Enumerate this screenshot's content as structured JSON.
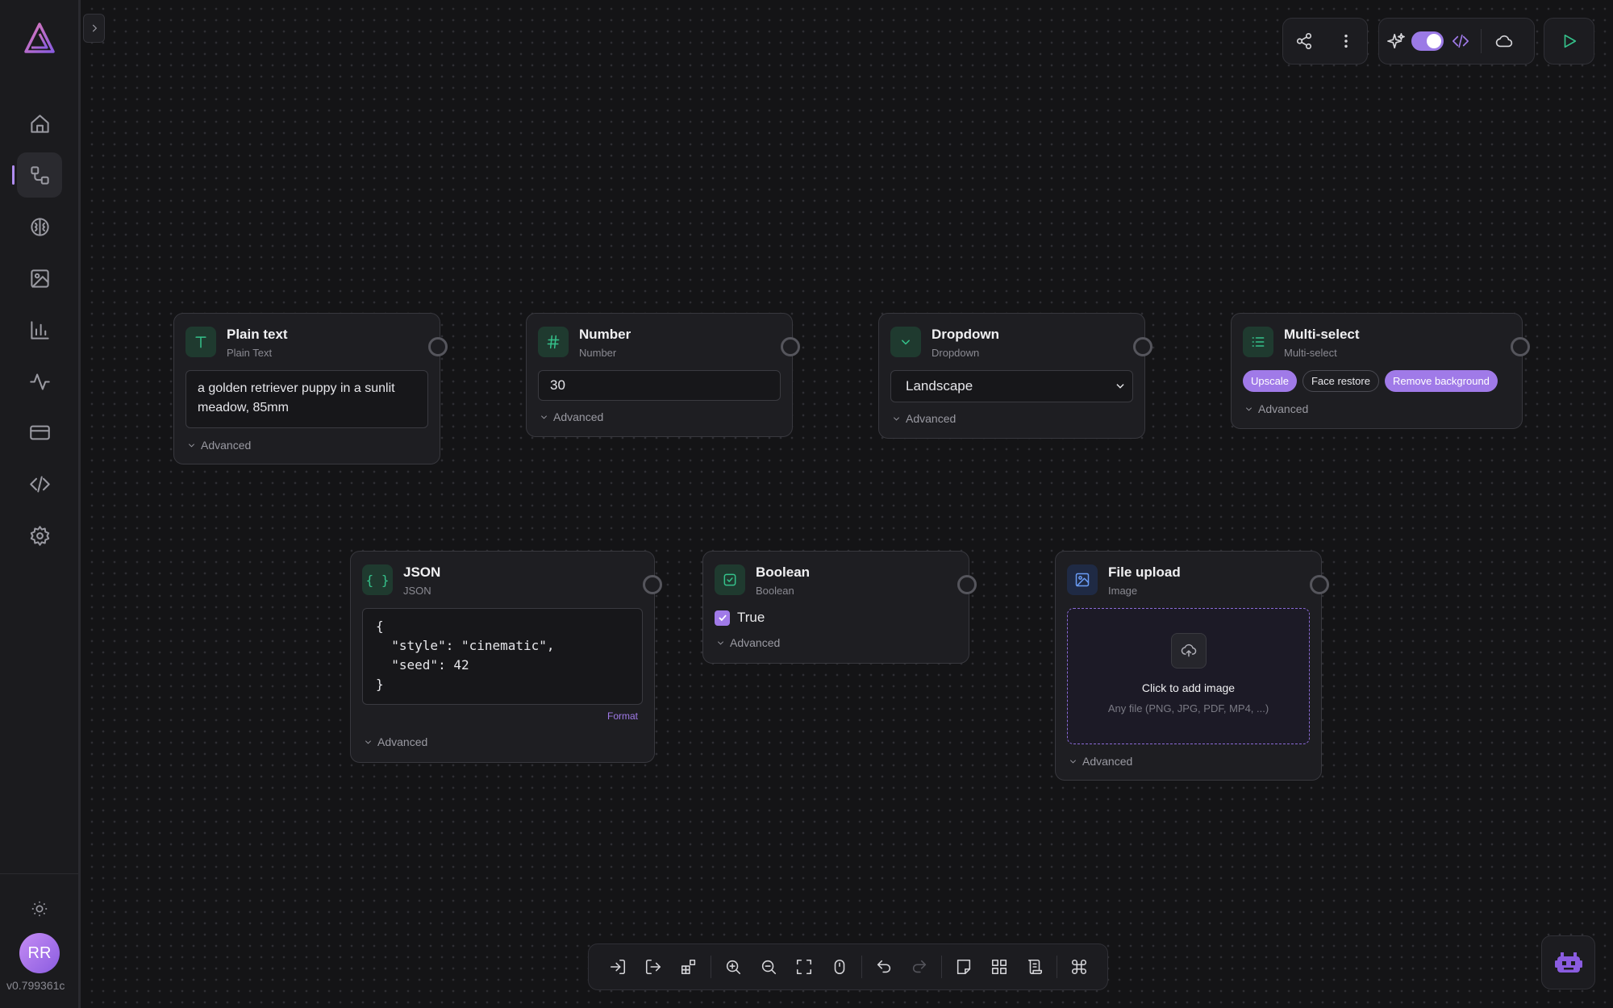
{
  "sidebar": {
    "nav": [
      {
        "name": "home",
        "icon": "home-icon"
      },
      {
        "name": "workflows",
        "icon": "workflow-icon",
        "active": true
      },
      {
        "name": "models",
        "icon": "brain-icon"
      },
      {
        "name": "gallery",
        "icon": "image-icon"
      },
      {
        "name": "analytics",
        "icon": "bar-chart-icon"
      },
      {
        "name": "activity",
        "icon": "activity-icon"
      },
      {
        "name": "billing",
        "icon": "credit-card-icon"
      },
      {
        "name": "api",
        "icon": "code-icon"
      },
      {
        "name": "settings",
        "icon": "gear-icon"
      }
    ],
    "avatar_initials": "RR",
    "version": "v0.799361c"
  },
  "colors": {
    "accent": "#a07ae8",
    "node_icon": "#35c28b",
    "background": "#141416"
  },
  "nodes": {
    "plain_text": {
      "title": "Plain text",
      "subtitle": "Plain Text",
      "value": "a golden retriever puppy in a sunlit meadow, 85mm",
      "advanced": "Advanced"
    },
    "number": {
      "title": "Number",
      "subtitle": "Number",
      "value": "30",
      "advanced": "Advanced"
    },
    "dropdown": {
      "title": "Dropdown",
      "subtitle": "Dropdown",
      "selected": "Landscape",
      "advanced": "Advanced"
    },
    "multi_select": {
      "title": "Multi-select",
      "subtitle": "Multi-select",
      "options": [
        {
          "label": "Upscale",
          "selected": true
        },
        {
          "label": "Face restore",
          "selected": false
        },
        {
          "label": "Remove background",
          "selected": true
        }
      ],
      "advanced": "Advanced"
    },
    "json": {
      "title": "JSON",
      "subtitle": "JSON",
      "lines": [
        "{",
        "  \"style\": \"cinematic\",",
        "  \"seed\": 42",
        "}"
      ],
      "format": "Format",
      "advanced": "Advanced"
    },
    "boolean": {
      "title": "Boolean",
      "subtitle": "Boolean",
      "value_label": "True",
      "checked": true,
      "advanced": "Advanced"
    },
    "file_upload": {
      "title": "File upload",
      "subtitle": "Image",
      "prompt": "Click to add image",
      "hint": "Any file (PNG, JPG, PDF, MP4, ...)",
      "advanced": "Advanced"
    }
  }
}
